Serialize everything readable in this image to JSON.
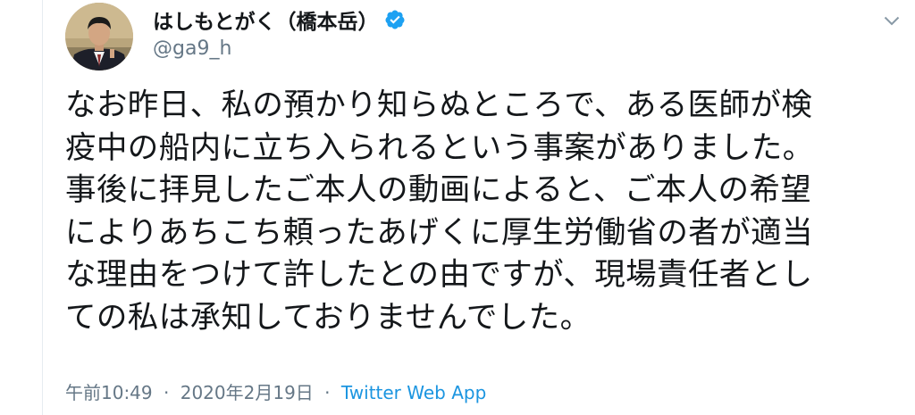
{
  "user": {
    "display_name": "はしもとがく（橋本岳）",
    "handle": "@ga9_h",
    "verified": true,
    "verified_color": "#1da1f2"
  },
  "tweet": {
    "lines": [
      "なお昨日、私の預かり知らぬところで、ある医師が検",
      "疫中の船内に立ち入られるという事案がありました。",
      "事後に拝見したご本人の動画によると、ご本人の希望",
      "によりあちこち頼ったあげくに厚生労働省の者が適当",
      "な理由をつけて許したとの由ですが、現場責任者とし",
      "ての私は承知しておりませんでした。"
    ],
    "time": "午前10:49",
    "date": "2020年2月19日",
    "separator": "·",
    "source": "Twitter Web App"
  },
  "icons": {
    "avatar": "profile-photo",
    "verified": "verified-badge-icon",
    "menu": "chevron-down-icon"
  }
}
